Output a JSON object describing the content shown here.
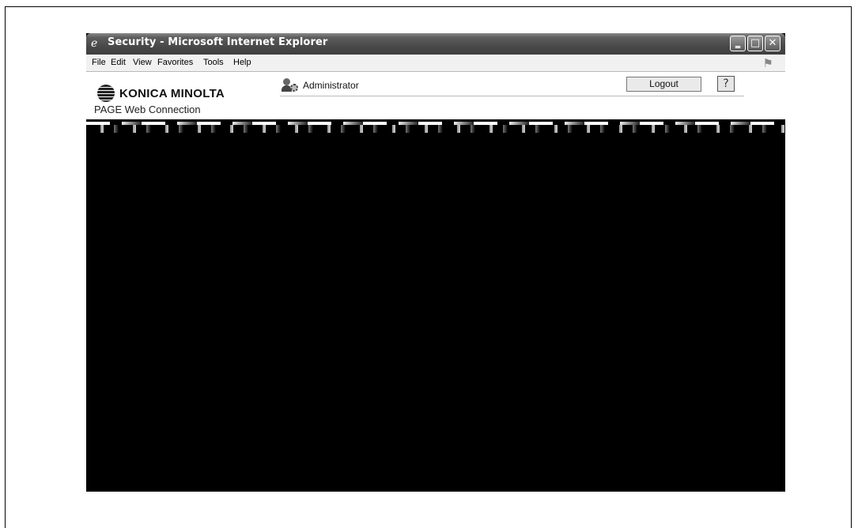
{
  "window": {
    "title": "Security - Microsoft Internet Explorer",
    "controls": {
      "minimize": "‗",
      "maximize": "□",
      "close": "✕"
    }
  },
  "menu": {
    "items": [
      {
        "key": "file",
        "label": "File"
      },
      {
        "key": "edit",
        "label": "Edit"
      },
      {
        "key": "view",
        "label": "View"
      },
      {
        "key": "favorites",
        "label": "Favorites"
      },
      {
        "key": "tools",
        "label": "Tools"
      },
      {
        "key": "help",
        "label": "Help"
      }
    ]
  },
  "header": {
    "brand": "KONICA MINOLTA",
    "user": "Administrator",
    "logout_label": "Logout",
    "help_symbol": "?"
  },
  "pagescope": {
    "text": "PAGE Web Connection"
  },
  "colors": {
    "titlebar": "#4a4a4a",
    "menubar": "#f1f1f1",
    "content_redacted": "#000000"
  }
}
